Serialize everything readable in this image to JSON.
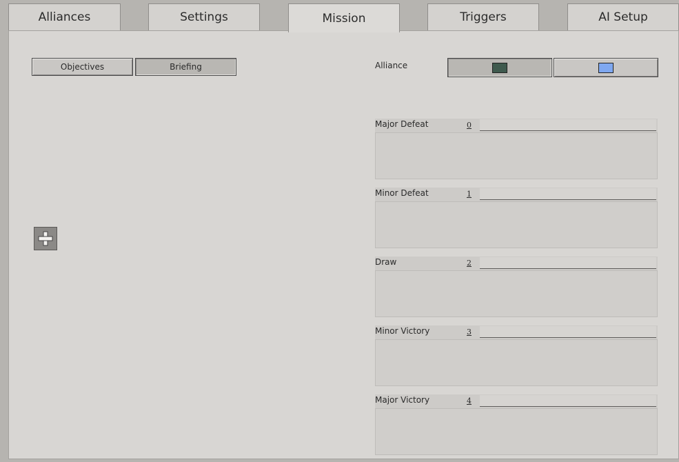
{
  "tabs": [
    {
      "label": "Alliances"
    },
    {
      "label": "Settings"
    },
    {
      "label": "Mission"
    },
    {
      "label": "Triggers"
    },
    {
      "label": "AI Setup"
    }
  ],
  "active_tab": "Mission",
  "subtabs": {
    "objectives_label": "Objectives",
    "briefing_label": "Briefing"
  },
  "alliance": {
    "label": "Alliance",
    "colors": [
      "#3f5a4e",
      "#7fa8f0"
    ],
    "icons": [
      "dark-green-swatch-icon",
      "light-blue-swatch-icon"
    ]
  },
  "add_icon": "plus-icon",
  "outcomes": [
    {
      "label": "Major Defeat",
      "number": "0",
      "field_value": "",
      "text": ""
    },
    {
      "label": "Minor Defeat",
      "number": "1",
      "field_value": "",
      "text": ""
    },
    {
      "label": "Draw",
      "number": "2",
      "field_value": "",
      "text": ""
    },
    {
      "label": "Minor Victory",
      "number": "3",
      "field_value": "",
      "text": ""
    },
    {
      "label": "Major Victory",
      "number": "4",
      "field_value": "",
      "text": ""
    }
  ]
}
